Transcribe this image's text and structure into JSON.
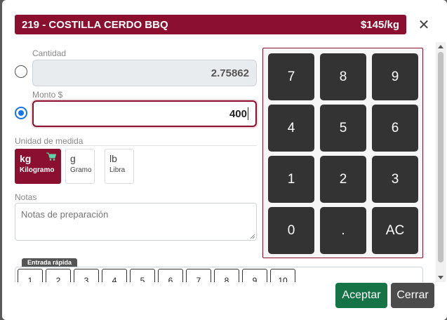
{
  "header": {
    "title": "219 - COSTILLA CERDO BBQ",
    "price": "$145/kg"
  },
  "close_icon": "close-icon",
  "form": {
    "cantidad_label": "Cantidad",
    "cantidad_value": "2.75862",
    "monto_label": "Monto $",
    "monto_value": "400",
    "selected_mode": "monto",
    "unidad_label": "Unidad de medida",
    "units": [
      {
        "abbr": "kg",
        "name": "Kilogramo",
        "selected": true
      },
      {
        "abbr": "g",
        "name": "Gramo",
        "selected": false
      },
      {
        "abbr": "lb",
        "name": "Libra",
        "selected": false
      }
    ],
    "notas_label": "Notas",
    "notas_placeholder": "Notas de preparación"
  },
  "keypad": {
    "keys": [
      "7",
      "8",
      "9",
      "4",
      "5",
      "6",
      "1",
      "2",
      "3",
      "0",
      ".",
      "AC"
    ]
  },
  "quick_entry": {
    "legend": "Entrada rápida",
    "buttons": [
      "1",
      "2",
      "3",
      "4",
      "5",
      "6",
      "7",
      "8",
      "9",
      "10"
    ]
  },
  "footer": {
    "accept_label": "Aceptar",
    "close_label": "Cerrar"
  },
  "colors": {
    "brand": "#8b1030",
    "accept": "#157347",
    "close": "#4b4b4b",
    "key": "#333333"
  }
}
